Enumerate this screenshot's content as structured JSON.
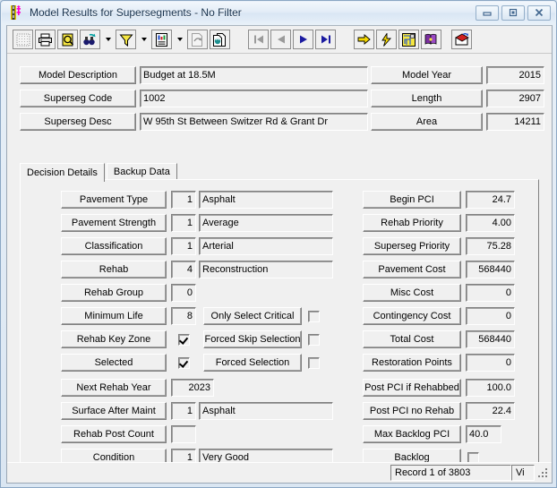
{
  "window": {
    "title": "Model Results for Supersegments - No Filter",
    "icon": "road-segment-icon",
    "buttons": [
      {
        "name": "minimize-button",
        "label": "–"
      },
      {
        "name": "maximize-button",
        "label": "□"
      },
      {
        "name": "close-button",
        "label": "✕"
      }
    ]
  },
  "toolbar": {
    "items": [
      {
        "name": "grid-button",
        "icon": "grid-icon",
        "tooltip": "Grid"
      },
      {
        "name": "print-button",
        "icon": "printer-icon",
        "tooltip": "Print"
      },
      {
        "name": "print-preview-button",
        "icon": "magnifier-page-icon",
        "tooltip": "Print Preview"
      },
      {
        "name": "find-button",
        "icon": "binoculars-icon",
        "tooltip": "Find"
      },
      {
        "name": "find-dropdown",
        "icon": "chevron-down-icon",
        "tooltip": "Find options"
      },
      {
        "name": "filter-button",
        "icon": "funnel-icon",
        "tooltip": "Filter"
      },
      {
        "name": "filter-dropdown",
        "icon": "chevron-down-icon",
        "tooltip": "Filter options"
      },
      {
        "name": "report-button",
        "icon": "report-icon",
        "tooltip": "Report"
      },
      {
        "name": "report-dropdown",
        "icon": "chevron-down-icon",
        "tooltip": "Report options"
      },
      {
        "name": "export-button",
        "icon": "export-page-icon",
        "tooltip": "Export"
      },
      {
        "name": "copy-button",
        "icon": "copy-pages-icon",
        "tooltip": "Copy"
      },
      {
        "name": "first-record-button",
        "icon": "first-record-icon",
        "tooltip": "First Record"
      },
      {
        "name": "previous-record-button",
        "icon": "previous-record-icon",
        "tooltip": "Previous Record"
      },
      {
        "name": "next-record-button",
        "icon": "next-record-icon",
        "tooltip": "Next Record"
      },
      {
        "name": "last-record-button",
        "icon": "last-record-icon",
        "tooltip": "Last Record"
      },
      {
        "name": "goto-button",
        "icon": "yellow-arrow-icon",
        "tooltip": "Go To"
      },
      {
        "name": "run-button",
        "icon": "lightning-icon",
        "tooltip": "Run"
      },
      {
        "name": "map-button",
        "icon": "map-icon",
        "tooltip": "Map"
      },
      {
        "name": "help-book-button",
        "icon": "purple-book-icon",
        "tooltip": "Help"
      },
      {
        "name": "chart-button",
        "icon": "red-chart-icon",
        "tooltip": "Chart"
      }
    ]
  },
  "header": {
    "left": [
      {
        "label": "Model Description",
        "value": "Budget at 18.5M"
      },
      {
        "label": "Superseg Code",
        "value": "1002"
      },
      {
        "label": "Superseg Desc",
        "value": "W 95th St Between Switzer Rd & Grant Dr"
      }
    ],
    "right": [
      {
        "label": "Model Year",
        "value": "2015"
      },
      {
        "label": "Length",
        "value": "2907"
      },
      {
        "label": "Area",
        "value": "14211"
      }
    ]
  },
  "tabs": [
    {
      "label": "Decision Details",
      "active": true
    },
    {
      "label": "Backup Data",
      "active": false
    }
  ],
  "decision_details": {
    "left": [
      {
        "label": "Pavement Type",
        "code": "1",
        "text": "Asphalt"
      },
      {
        "label": "Pavement Strength",
        "code": "1",
        "text": "Average"
      },
      {
        "label": "Classification",
        "code": "1",
        "text": "Arterial"
      },
      {
        "label": "Rehab",
        "code": "4",
        "text": "Reconstruction"
      },
      {
        "label": "Rehab Group",
        "code": "0",
        "text": ""
      },
      {
        "label": "Minimum Life",
        "code": "8",
        "text": ""
      }
    ],
    "checkbox_rows": [
      {
        "label": "Rehab Key Zone",
        "checked": true
      },
      {
        "label": "Selected",
        "checked": true
      }
    ],
    "option_buttons": [
      {
        "label": "Only Select Critical",
        "checked": false
      },
      {
        "label": "Forced Skip Selection",
        "checked": false
      },
      {
        "label": "Forced Selection",
        "checked": false
      }
    ],
    "left_bottom": [
      {
        "label": "Next Rehab Year",
        "code": "2023",
        "text": null,
        "wide_code": true
      },
      {
        "label": "Surface After Maint",
        "code": "1",
        "text": "Asphalt"
      },
      {
        "label": "Rehab Post Count",
        "code": "",
        "text": null
      },
      {
        "label": "Condition",
        "code": "1",
        "text": "Very Good"
      }
    ],
    "right": [
      {
        "label": "Begin PCI",
        "value": "24.7",
        "type": "value"
      },
      {
        "label": "Rehab Priority",
        "value": "4.00",
        "type": "value"
      },
      {
        "label": "Superseg Priority",
        "value": "75.28",
        "type": "value"
      },
      {
        "label": "Pavement Cost",
        "value": "568440",
        "type": "value"
      },
      {
        "label": "Misc Cost",
        "value": "0",
        "type": "value"
      },
      {
        "label": "Contingency Cost",
        "value": "0",
        "type": "value"
      },
      {
        "label": "Total Cost",
        "value": "568440",
        "type": "value"
      },
      {
        "label": "Restoration Points",
        "value": "0",
        "type": "value"
      },
      {
        "label": "Post PCI if Rehabbed",
        "value": "100.0",
        "type": "value"
      },
      {
        "label": "Post PCI no Rehab",
        "value": "22.4",
        "type": "value"
      },
      {
        "label": "Max Backlog PCI",
        "value": "40.0",
        "type": "value-left"
      },
      {
        "label": "Backlog",
        "value": "",
        "type": "checkbox",
        "checked": false
      }
    ]
  },
  "statusbar": {
    "record": "Record 1 of 3803",
    "mode": "Vi"
  }
}
